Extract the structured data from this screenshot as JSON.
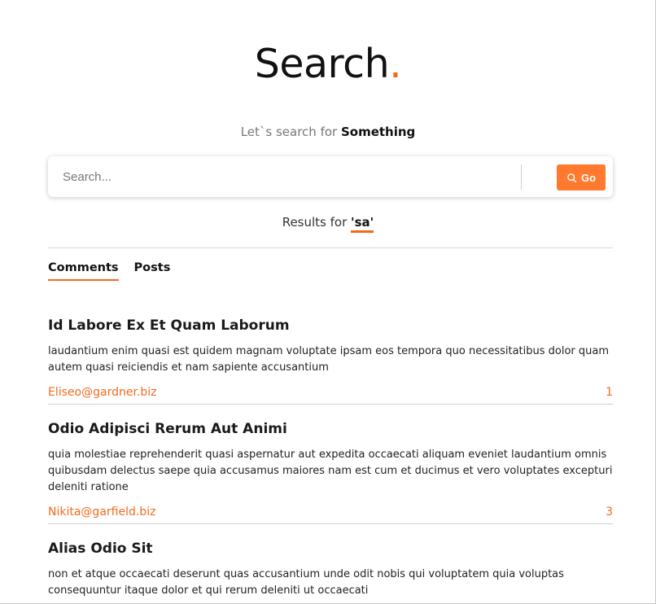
{
  "hero": {
    "title": "Search",
    "dot": "."
  },
  "subtitle": {
    "prefix": "Let`s search for ",
    "emphasis": "Something"
  },
  "search": {
    "placeholder": "Search...",
    "value": "",
    "button_label": "Go"
  },
  "results_header": {
    "prefix": "Results for ",
    "query": "'sa'"
  },
  "tabs": [
    {
      "label": "Comments",
      "active": true
    },
    {
      "label": "Posts",
      "active": false
    }
  ],
  "comments": [
    {
      "title": "Id Labore Ex Et Quam Laborum",
      "body": "laudantium enim quasi est quidem magnam voluptate ipsam eos tempora quo necessitatibus dolor quam autem quasi reiciendis et nam sapiente accusantium",
      "email": "Eliseo@gardner.biz",
      "count": "1"
    },
    {
      "title": "Odio Adipisci Rerum Aut Animi",
      "body": "quia molestiae reprehenderit quasi aspernatur aut expedita occaecati aliquam eveniet laudantium omnis quibusdam delectus saepe quia accusamus maiores nam est cum et ducimus et vero voluptates excepturi deleniti ratione",
      "email": "Nikita@garfield.biz",
      "count": "3"
    },
    {
      "title": "Alias Odio Sit",
      "body": "non et atque occaecati deserunt quas accusantium unde odit nobis qui voluptatem quia voluptas consequuntur itaque dolor et qui rerum deleniti ut occaecati",
      "email": "",
      "count": ""
    }
  ],
  "colors": {
    "accent": "#f26b1d",
    "button": "#ff7a2e"
  },
  "icons": {
    "go_button": "search-icon"
  }
}
